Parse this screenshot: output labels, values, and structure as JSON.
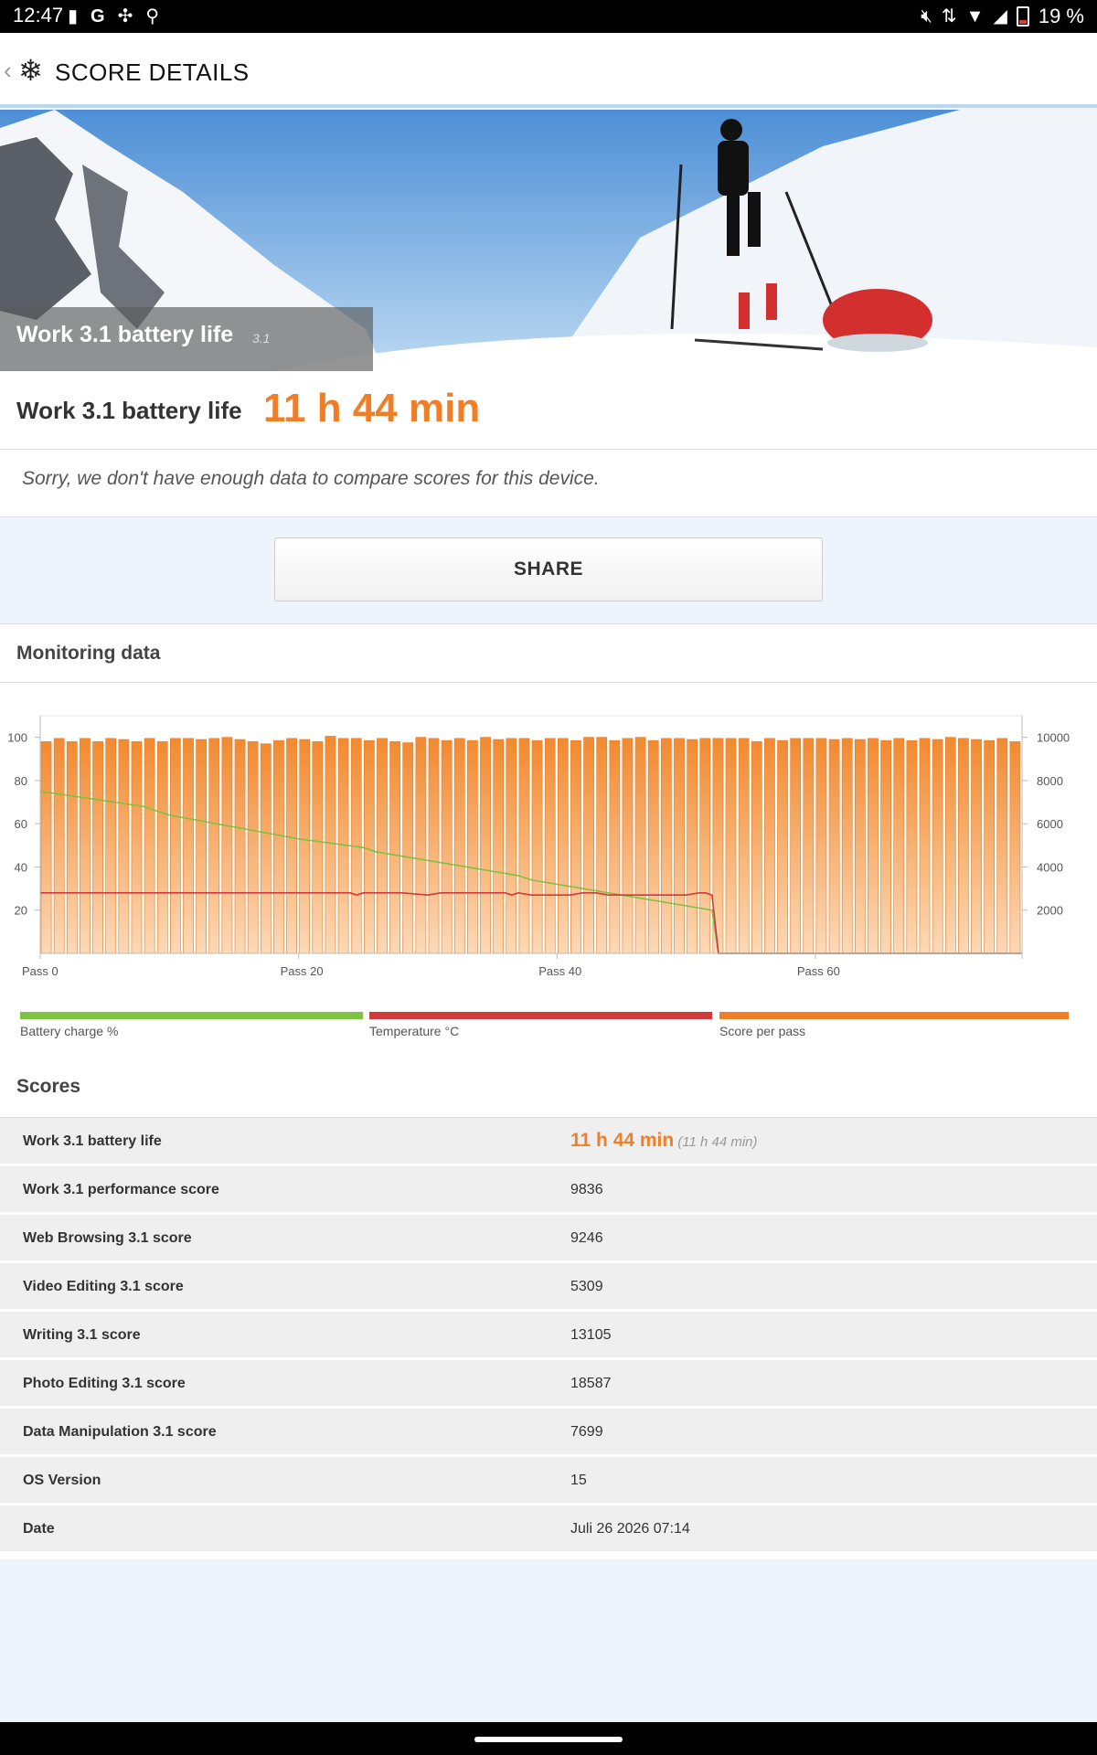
{
  "status_bar": {
    "time": "12:47",
    "battery_pct": "19 %",
    "left_icons": [
      "battery-alert-icon",
      "google-icon",
      "fan-icon",
      "pin-icon"
    ],
    "right_icons": [
      "mute-icon",
      "data-arrows-icon",
      "wifi-icon",
      "signal-icon",
      "battery-icon"
    ]
  },
  "app_bar": {
    "title": "SCORE DETAILS",
    "back_icon": "back-chevron-icon",
    "logo_icon": "3dmark-logo-icon"
  },
  "hero": {
    "title": "Work 3.1 battery life",
    "version": "3.1"
  },
  "result": {
    "label": "Work 3.1 battery life",
    "value": "11 h 44 min",
    "message": "Sorry, we don't have enough data to compare scores for this device."
  },
  "share_label": "SHARE",
  "monitoring": {
    "title": "Monitoring data",
    "legend": [
      {
        "label": "Battery charge %",
        "color": "#7dc242"
      },
      {
        "label": "Temperature °C",
        "color": "#d03a3a"
      },
      {
        "label": "Score per pass",
        "color": "#f07e26"
      }
    ]
  },
  "chart_data": {
    "type": "bar",
    "x_ticks": [
      "Pass 0",
      "Pass 20",
      "Pass 40",
      "Pass 60"
    ],
    "x_tick_positions": [
      0,
      20,
      40,
      60
    ],
    "x_range": [
      0,
      76
    ],
    "y_left_ticks": [
      20,
      40,
      60,
      80,
      100
    ],
    "y_left_range": [
      0,
      110
    ],
    "y_right_ticks": [
      2000,
      4000,
      6000,
      8000,
      10000
    ],
    "y_right_range": [
      0,
      11000
    ],
    "grid": false,
    "series": [
      {
        "name": "Score per pass",
        "axis": "right",
        "values": [
          9800,
          9950,
          9800,
          9950,
          9800,
          9950,
          9900,
          9800,
          9950,
          9800,
          9950,
          9950,
          9900,
          9950,
          10000,
          9900,
          9800,
          9700,
          9850,
          9950,
          9900,
          9800,
          10050,
          9950,
          9950,
          9850,
          9950,
          9800,
          9750,
          10000,
          9950,
          9850,
          9950,
          9850,
          10000,
          9900,
          9950,
          9950,
          9850,
          9950,
          9950,
          9850,
          10000,
          10000,
          9850,
          9950,
          10000,
          9850,
          9950,
          9950,
          9900,
          9950,
          9950,
          9950,
          9950,
          9800,
          9950,
          9850,
          9950,
          9950,
          9950,
          9900,
          9950,
          9900,
          9950,
          9850,
          9950,
          9850,
          9950,
          9900,
          10000,
          9950,
          9900,
          9850,
          9950,
          9800
        ]
      },
      {
        "name": "Battery charge %",
        "axis": "left",
        "x": [
          0,
          8,
          10,
          20,
          25,
          26,
          37,
          38,
          51,
          52,
          52.5,
          76
        ],
        "values": [
          75,
          68,
          64,
          53,
          49,
          47,
          36,
          34,
          21,
          20,
          0,
          0
        ]
      },
      {
        "name": "Temperature °C",
        "axis": "left",
        "x": [
          0,
          5,
          10,
          15,
          20,
          24,
          24.5,
          25,
          26,
          28,
          30,
          31,
          32,
          34,
          36,
          36.5,
          37,
          38,
          40,
          41,
          42,
          43,
          44,
          45,
          47,
          49,
          50,
          51,
          51.5,
          52,
          52.5,
          76
        ],
        "values": [
          28,
          28,
          28,
          28,
          28,
          28,
          27,
          28,
          28,
          28,
          27,
          28,
          28,
          28,
          28,
          27,
          28,
          27,
          27,
          27,
          28,
          28,
          27,
          27,
          27,
          27,
          27,
          28,
          28,
          27,
          0,
          0
        ]
      }
    ]
  },
  "scores": {
    "title": "Scores",
    "rows": [
      {
        "name": "Work 3.1 battery life",
        "value": "11 h 44 min",
        "sub": "(11 h 44 min)"
      },
      {
        "name": "Work 3.1 performance score",
        "value": "9836"
      },
      {
        "name": "Web Browsing 3.1 score",
        "value": "9246"
      },
      {
        "name": "Video Editing 3.1 score",
        "value": "5309"
      },
      {
        "name": "Writing 3.1 score",
        "value": "13105"
      },
      {
        "name": "Photo Editing 3.1 score",
        "value": "18587"
      },
      {
        "name": "Data Manipulation 3.1 score",
        "value": "7699"
      },
      {
        "name": "OS Version",
        "value": "15"
      },
      {
        "name": "Date",
        "value": "Juli 26 2026 07:14"
      }
    ]
  }
}
